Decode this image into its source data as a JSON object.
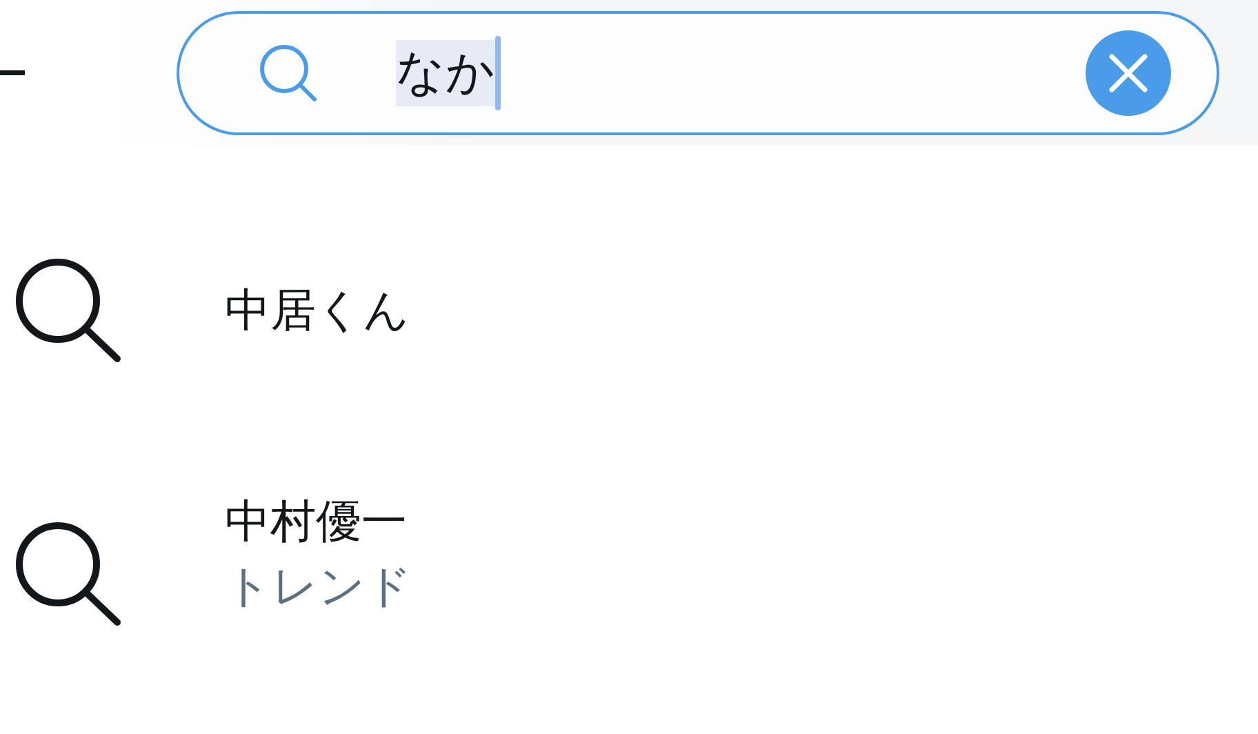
{
  "search": {
    "value": "なか",
    "value_selected": true
  },
  "suggestions": [
    {
      "title": "中居くん"
    },
    {
      "title": "中村優一",
      "subtitle": "トレンド"
    }
  ]
}
